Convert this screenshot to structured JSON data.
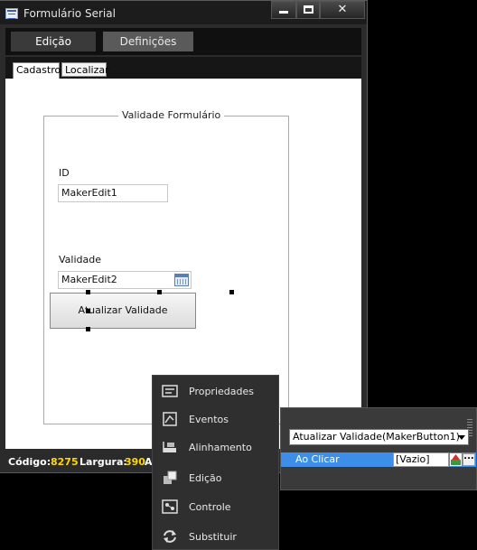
{
  "window": {
    "title": "Formulário Serial",
    "close_glyph": "✕",
    "tabs": [
      {
        "label": "Edição",
        "active": true
      },
      {
        "label": "Definições",
        "active": false
      }
    ]
  },
  "form": {
    "tabs": [
      {
        "label": "Cadastro",
        "active": true
      },
      {
        "label": "Localizar",
        "active": false
      }
    ],
    "group_caption": "Validade Formulário",
    "id_label": "ID",
    "id_value": "MakerEdit1",
    "validade_label": "Validade",
    "validade_value": "MakerEdit2",
    "button_label": "Atualizar Validade"
  },
  "status": {
    "codigo_label": "Código:",
    "codigo_value": "8275",
    "largura_label": "Largura:",
    "largura_value": "390",
    "partial_label": "A"
  },
  "context_menu": {
    "items": [
      {
        "label": "Propriedades",
        "icon": "properties-icon"
      },
      {
        "label": "Eventos",
        "icon": "events-icon"
      },
      {
        "label": "Alinhamento",
        "icon": "alignment-icon"
      },
      {
        "label": "Edição",
        "icon": "edit-icon"
      },
      {
        "label": "Controle",
        "icon": "control-icon"
      },
      {
        "label": "Substituir",
        "icon": "replace-icon"
      }
    ]
  },
  "events_panel": {
    "selected_object": "Atualizar Validade(MakerButton1)",
    "event_name": "Ao Clicar",
    "event_value": "[Vazio]",
    "more_label": "..."
  },
  "colors": {
    "status_value": "#ffd800",
    "event_highlight": "#3c8ee8"
  }
}
